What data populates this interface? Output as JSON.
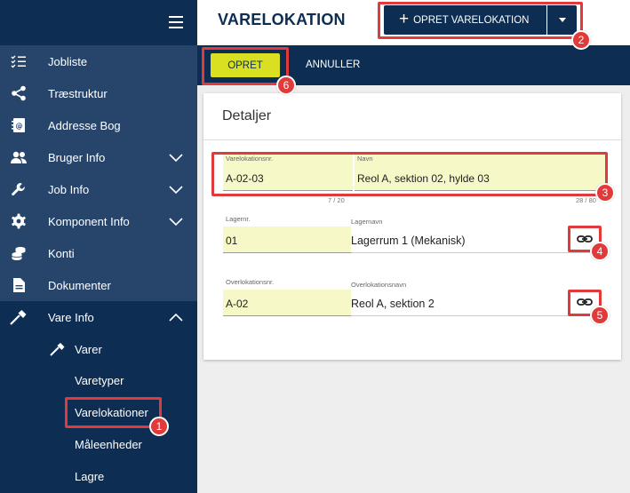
{
  "sidebar": {
    "items": [
      {
        "label": "Jobliste",
        "icon": "checklist-icon"
      },
      {
        "label": "Træstruktur",
        "icon": "share-tree-icon"
      },
      {
        "label": "Addresse Bog",
        "icon": "address-book-icon"
      },
      {
        "label": "Bruger Info",
        "icon": "users-icon"
      },
      {
        "label": "Job Info",
        "icon": "wrench-icon"
      },
      {
        "label": "Komponent Info",
        "icon": "gear-icon"
      },
      {
        "label": "Konti",
        "icon": "coins-icon"
      },
      {
        "label": "Dokumenter",
        "icon": "document-icon"
      },
      {
        "label": "Vare Info",
        "icon": "hammer-icon"
      }
    ],
    "subitems": [
      {
        "label": "Varer"
      },
      {
        "label": "Varetyper"
      },
      {
        "label": "Varelokationer"
      },
      {
        "label": "Måleenheder"
      },
      {
        "label": "Lagre"
      }
    ]
  },
  "header": {
    "title": "VARELOKATION",
    "create_button": "OPRET VARELOKATION"
  },
  "actions": {
    "save": "OPRET",
    "cancel": "ANNULLER"
  },
  "card": {
    "title": "Detaljer",
    "location_no": {
      "label": "Varelokationsnr.",
      "value": "A-02-03",
      "counter": "7 / 20"
    },
    "name": {
      "label": "Navn",
      "value": "Reol A, sektion 02, hylde 03",
      "counter": "28 / 80"
    },
    "warehouse_no": {
      "label": "Lagernr.",
      "value": "01"
    },
    "warehouse_name": {
      "label": "Lagernavn",
      "value": "Lagerrum 1 (Mekanisk)"
    },
    "parent_no": {
      "label": "Overlokationsnr.",
      "value": "A-02"
    },
    "parent_name": {
      "label": "Overlokationsnavn",
      "value": "Reol A, sektion 2"
    }
  },
  "callouts": [
    "1",
    "2",
    "3",
    "4",
    "5",
    "6"
  ],
  "colors": {
    "navy": "#0d2d52",
    "sidebar": "#27456b",
    "accent_yellow": "#d9e021",
    "field_bg": "#f6f8c8",
    "callout_red": "#e03a3a"
  }
}
